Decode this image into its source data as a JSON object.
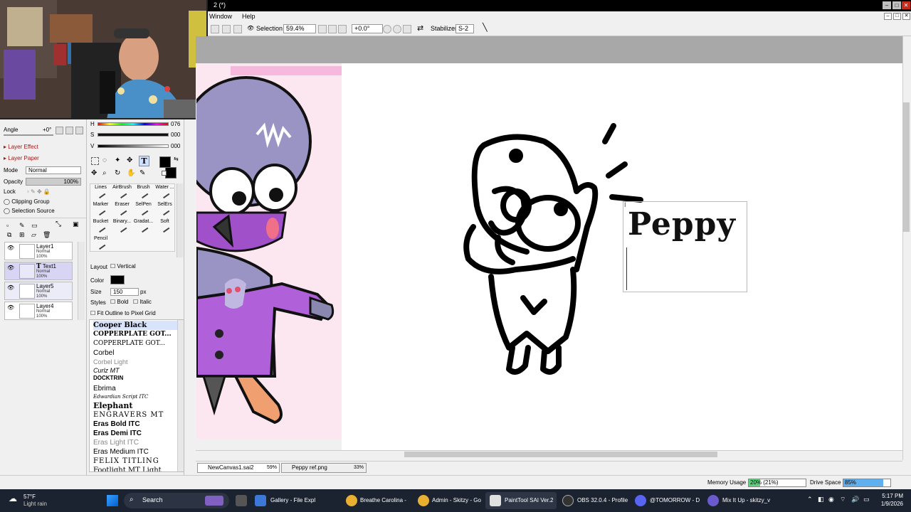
{
  "window": {
    "title": "2 (*)"
  },
  "menu": {
    "items": [
      "Window",
      "Help"
    ]
  },
  "toolbar": {
    "selection_label": "Selection",
    "zoom": "59.4%",
    "rotation": "+0.0°",
    "stabilizer_label": "Stabilizer",
    "stabilizer_value": "S-2"
  },
  "left_panel": {
    "angle_label": "Angle",
    "angle_value": "+0°",
    "layer_effect": "Layer Effect",
    "layer_paper": "Layer Paper",
    "mode_label": "Mode",
    "mode_value": "Normal",
    "opacity_label": "Opacity",
    "opacity_value": "100%",
    "lock_label": "Lock",
    "clipping_group": "Clipping Group",
    "selection_source": "Selection Source",
    "layers": [
      {
        "name": "Layer1",
        "mode": "Normal",
        "opacity": "100%"
      },
      {
        "name": "Text1",
        "mode": "Normal",
        "opacity": "100%"
      },
      {
        "name": "Layer5",
        "mode": "Normal",
        "opacity": "100%"
      },
      {
        "name": "Layer4",
        "mode": "Normal",
        "opacity": "100%"
      }
    ]
  },
  "color": {
    "h_label": "H",
    "h_value": "076",
    "s_label": "S",
    "s_value": "000",
    "v_label": "V",
    "v_value": "000"
  },
  "tools": {
    "cells": [
      "Lines",
      "AirBrush",
      "Brush",
      "Water ...",
      "Marker",
      "Eraser",
      "SelPen",
      "SelErs",
      "Bucket",
      "Binary...",
      "Gradat...",
      "Soft",
      "Pencil"
    ]
  },
  "text_tool": {
    "layout_label": "Layout",
    "vertical_label": "Vertical",
    "color_label": "Color",
    "size_label": "Size",
    "size_value": "150",
    "size_unit": "px",
    "styles_label": "Styles",
    "bold_label": "Bold",
    "italic_label": "Italic",
    "fit_outline": "Fit Outline to Pixel Grid",
    "fonts": [
      "Cooper Black",
      "COPPERPLATE GOT...",
      "COPPERPLATE GOT...",
      "Corbel",
      "Corbel Light",
      "Curlz MT",
      "DOCKTRIN",
      "Ebrima",
      "Edwardian Script ITC",
      "Elephant",
      "ENGRAVERS MT",
      "Eras Bold ITC",
      "Eras Demi ITC",
      "Eras Light ITC",
      "Eras Medium ITC",
      "FELIX TITLING",
      "Footlight MT Light"
    ]
  },
  "canvas": {
    "text_content": "Peppy"
  },
  "canvas_tabs": [
    {
      "name": "NewCanvas1.sai2",
      "zoom": "59%"
    },
    {
      "name": "Peppy ref.png",
      "zoom": "33%"
    }
  ],
  "status": {
    "memory_label": "Memory Usage",
    "memory_value": "20% (21%)",
    "memory_fraction": 0.2,
    "drive_label": "Drive Space",
    "drive_value": "85%",
    "drive_fraction": 0.85
  },
  "taskbar": {
    "weather_temp": "57°F",
    "weather_desc": "Light rain",
    "search_label": "Search",
    "apps": [
      "Gallery - File Expl",
      "Breathe Carolina -",
      "Admin - Skitzy - Go",
      "PaintTool SAI Ver.2",
      "OBS 32.0.4 - Profile",
      "@TOMORROW - D",
      "Mix It Up - skitzy_v"
    ],
    "time": "5:17 PM",
    "date": "1/9/2026"
  }
}
